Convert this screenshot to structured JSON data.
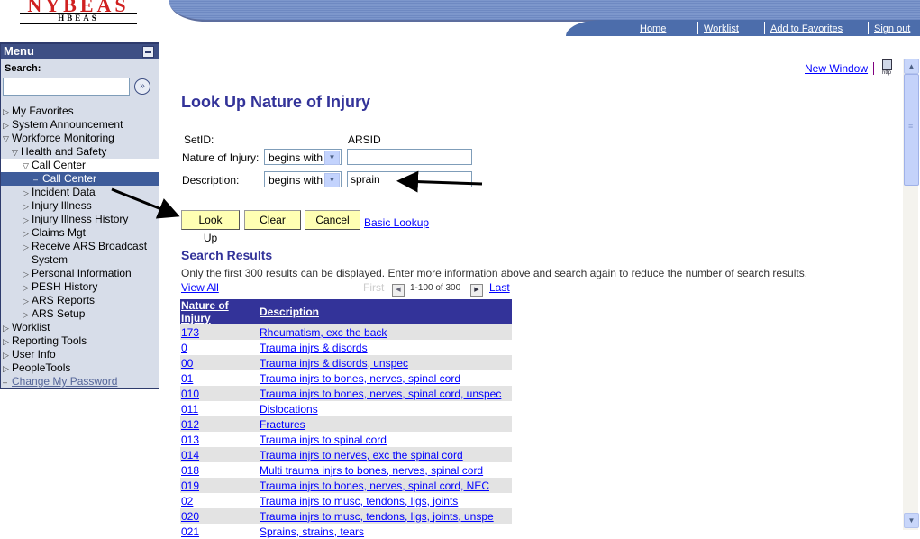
{
  "header": {
    "logo_main": "NYBEAS",
    "logo_sub": "HBEAS",
    "nav": [
      "Home",
      "Worklist",
      "Add to Favorites",
      "Sign out"
    ]
  },
  "menu": {
    "title": "Menu",
    "search_label": "Search:",
    "search_value": "",
    "items": [
      {
        "label": "My Favorites",
        "level": 0,
        "icon": "triangle-right"
      },
      {
        "label": "System Announcement",
        "level": 0,
        "icon": "triangle-right"
      },
      {
        "label": "Workforce Monitoring",
        "level": 0,
        "icon": "triangle-down"
      },
      {
        "label": "Health and Safety",
        "level": 1,
        "icon": "triangle-down"
      },
      {
        "label": "Call Center",
        "level": 2,
        "icon": "triangle-down"
      },
      {
        "label": "Call Center",
        "level": 3,
        "icon": "dash"
      },
      {
        "label": "Incident Data",
        "level": 2,
        "icon": "triangle-right"
      },
      {
        "label": "Injury Illness",
        "level": 2,
        "icon": "triangle-right"
      },
      {
        "label": "Injury Illness History",
        "level": 2,
        "icon": "triangle-right"
      },
      {
        "label": "Claims Mgt",
        "level": 2,
        "icon": "triangle-right"
      },
      {
        "label": "Receive ARS Broadcast",
        "level": 2,
        "icon": "triangle-right"
      },
      {
        "label": "System",
        "level": 2,
        "icon": "none"
      },
      {
        "label": "Personal Information",
        "level": 2,
        "icon": "triangle-right"
      },
      {
        "label": "PESH History",
        "level": 2,
        "icon": "triangle-right"
      },
      {
        "label": "ARS Reports",
        "level": 2,
        "icon": "triangle-right"
      },
      {
        "label": "ARS Setup",
        "level": 2,
        "icon": "triangle-right"
      },
      {
        "label": "Worklist",
        "level": 0,
        "icon": "triangle-right"
      },
      {
        "label": "Reporting Tools",
        "level": 0,
        "icon": "triangle-right"
      },
      {
        "label": "User Info",
        "level": 0,
        "icon": "triangle-right"
      },
      {
        "label": "PeopleTools",
        "level": 0,
        "icon": "triangle-right"
      },
      {
        "label": "Change My Password",
        "level": 0,
        "icon": "dash"
      }
    ]
  },
  "page": {
    "new_window": "New Window",
    "http_icon_label": "http",
    "title": "Look Up Nature of Injury",
    "setid_label": "SetID:",
    "setid_value": "ARSID",
    "nature_label": "Nature of Injury:",
    "nature_operator": "begins with",
    "nature_value": "",
    "desc_label": "Description:",
    "desc_operator": "begins with",
    "desc_value": "sprain",
    "buttons": {
      "lookup": "Look Up",
      "clear": "Clear",
      "cancel": "Cancel"
    },
    "basic_lookup": "Basic Lookup"
  },
  "results": {
    "title": "Search Results",
    "note": "Only the first 300 results can be displayed. Enter more information above and search again to reduce the number of search results.",
    "view_all": "View All",
    "first": "First",
    "count": "1-100 of 300",
    "last": "Last",
    "columns": [
      "Nature of Injury",
      "Description"
    ],
    "rows": [
      [
        "173",
        "Rheumatism, exc the back"
      ],
      [
        "0",
        "Trauma injrs & disords"
      ],
      [
        "00",
        "Trauma injrs & disords, unspec"
      ],
      [
        "01",
        "Trauma injrs to bones, nerves, spinal cord"
      ],
      [
        "010",
        "Trauma injrs to bones, nerves, spinal cord, unspec"
      ],
      [
        "011",
        "Dislocations"
      ],
      [
        "012",
        "Fractures"
      ],
      [
        "013",
        "Trauma injrs to spinal cord"
      ],
      [
        "014",
        "Trauma injrs to nerves, exc the spinal cord"
      ],
      [
        "018",
        "Multi trauma injrs to bones, nerves, spinal cord"
      ],
      [
        "019",
        "Trauma injrs to bones, nerves, spinal cord, NEC"
      ],
      [
        "02",
        "Trauma injrs to musc, tendons, ligs, joints"
      ],
      [
        "020",
        "Trauma injrs to musc, tendons, ligs, joints, unspe"
      ],
      [
        "021",
        "Sprains, strains, tears"
      ]
    ]
  }
}
